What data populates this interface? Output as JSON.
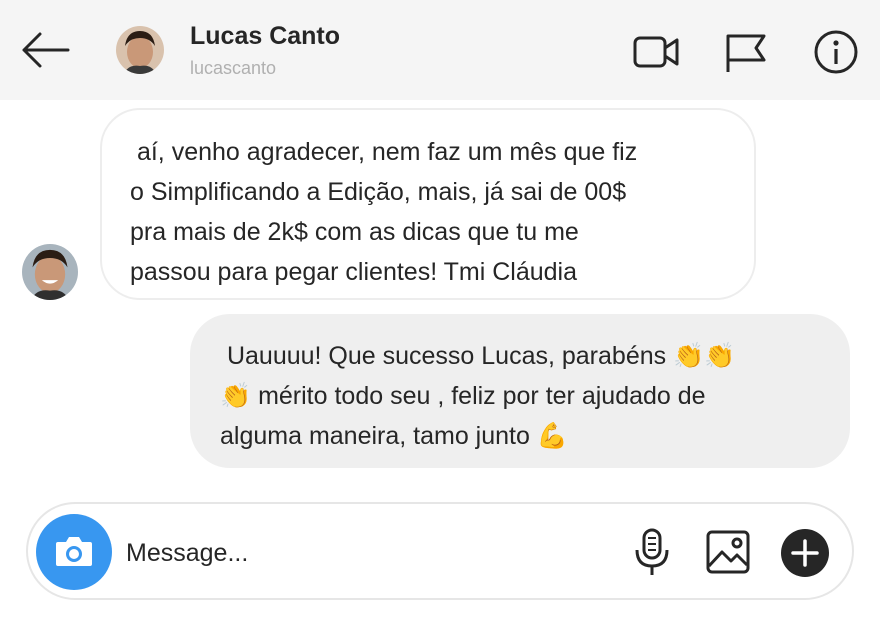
{
  "header": {
    "contact_name": "Lucas Canto",
    "contact_username": "lucascanto",
    "back_icon": "arrow-left-icon",
    "actions": [
      "video-call-icon",
      "flag-icon",
      "info-icon"
    ]
  },
  "messages": [
    {
      "direction": "incoming",
      "text": " aí, venho agradecer, nem faz um mês que fiz\no Simplificando a Edição, mais, já sai de 00$\npra mais de 2k$ com as dicas que tu me\npassou para pegar clientes! Tmi Cláudia"
    },
    {
      "direction": "outgoing",
      "text": " Uauuuu! Que sucesso Lucas, parabéns 👏👏\n👏 mérito todo seu , feliz por ter ajudado de\nalguma maneira, tamo junto 💪"
    }
  ],
  "composer": {
    "placeholder": "Message...",
    "value": "",
    "icons": [
      "camera-icon",
      "microphone-icon",
      "image-icon",
      "plus-icon"
    ]
  },
  "colors": {
    "accent": "#3897f0",
    "header_bg": "#f5f5f5",
    "outgoing_bubble": "#efefef",
    "incoming_border": "#ededed"
  }
}
